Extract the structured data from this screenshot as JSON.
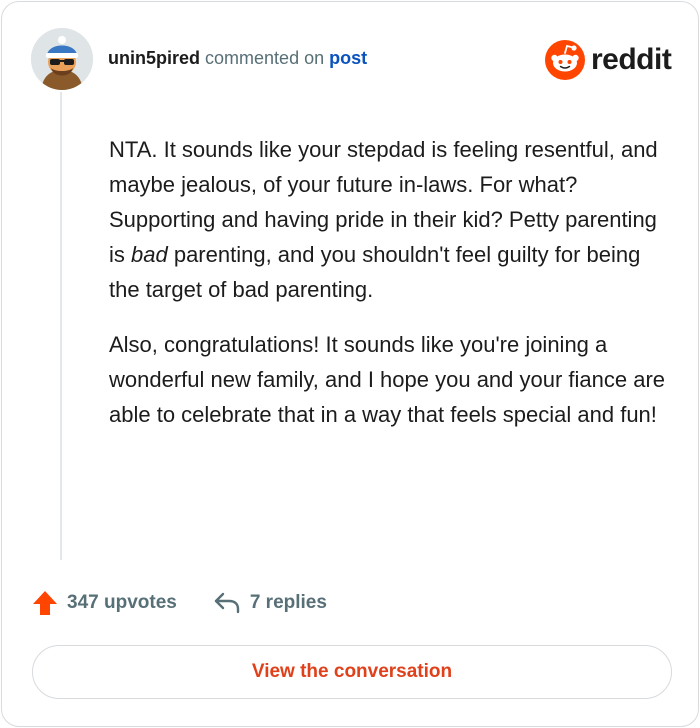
{
  "header": {
    "username": "unin5pired",
    "action_text": "commented on",
    "post_link": "post"
  },
  "brand": {
    "wordmark": "reddit",
    "icon": "reddit-logo-icon",
    "accent_color": "#ff4500"
  },
  "comment": {
    "paragraph1_before": "NTA. It sounds like your stepdad is feeling resentful, and maybe jealous, of your future in-laws. For what? Supporting and having pride in their kid? Petty parenting is ",
    "paragraph1_emphasis": "bad",
    "paragraph1_after": " parenting, and you shouldn't feel guilty for being the target of bad parenting.",
    "paragraph2": "Also, congratulations! It sounds like you're joining a wonderful new family, and I hope you and your fiance are able to celebrate that in a way that feels special and fun!"
  },
  "footer": {
    "upvotes_label": "347 upvotes",
    "upvote_icon": "upvote-arrow-icon",
    "replies_label": "7 replies",
    "reply_icon": "reply-arrow-icon"
  },
  "cta": {
    "label": "View the conversation",
    "color": "#e0401a"
  }
}
